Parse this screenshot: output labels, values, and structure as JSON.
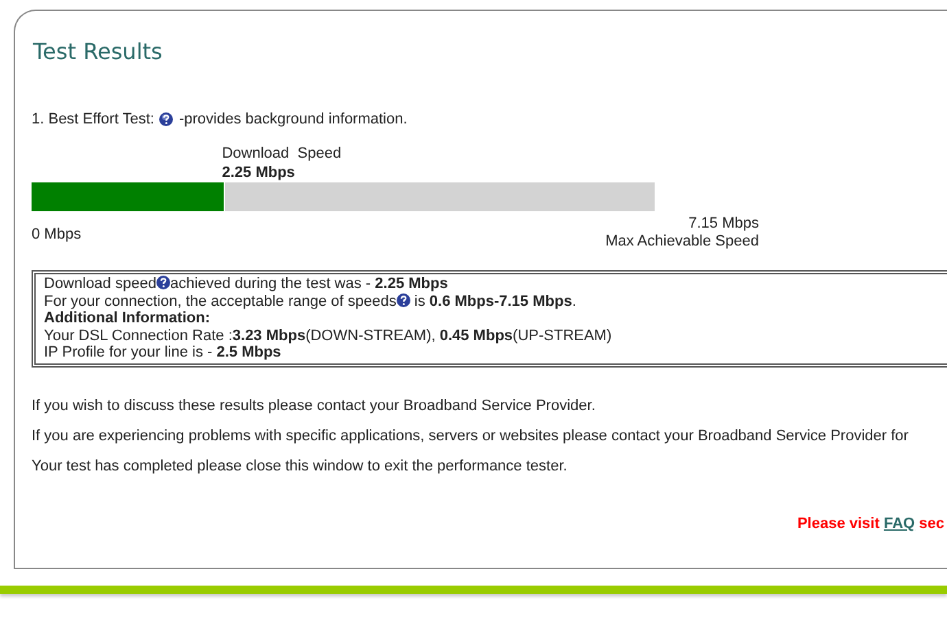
{
  "title": "Test Results",
  "test": {
    "prefix": "1. Best Effort Test:",
    "suffix": "-provides background information."
  },
  "gauge": {
    "label": "Download  Speed",
    "value": "2.25 Mbps",
    "level": 0.31,
    "min": "0 Mbps",
    "max": "7.15 Mbps",
    "max_label": "Max Achievable Speed"
  },
  "info": [
    {
      "kind": "text",
      "parts": [
        {
          "kind": "text",
          "text": "Download speed"
        },
        {
          "kind": "help"
        },
        {
          "kind": "text",
          "text": "achieved during the test was - **2.25 Mbps**"
        }
      ]
    },
    {
      "kind": "text",
      "parts": [
        {
          "kind": "text",
          "text": "For your connection, the acceptable range of speeds"
        },
        {
          "kind": "help"
        },
        {
          "kind": "text",
          "text": " is **0.6 Mbps-7.15 Mbps**."
        }
      ]
    },
    {
      "kind": "heading",
      "parts": [
        {
          "kind": "text",
          "text": "Additional Information:"
        }
      ]
    },
    {
      "kind": "text",
      "parts": [
        {
          "kind": "text",
          "text": "Your DSL Connection Rate :**3.23 Mbps**(DOWN-STREAM), **0.45 Mbps**(UP-STREAM)"
        }
      ]
    },
    {
      "kind": "text",
      "parts": [
        {
          "kind": "text",
          "text": "IP Profile for your line is - **2.5 Mbps**"
        }
      ]
    }
  ],
  "messages": [
    "If you wish to discuss these results please contact your Broadband Service Provider.",
    "If you are experiencing problems with specific applications, servers or websites please contact your Broadband Service Provider for",
    "Your test has completed please close this window to exit the performance tester."
  ],
  "notice": {
    "before": "Please visit",
    "link": "FAQ",
    "after": "sec"
  }
}
